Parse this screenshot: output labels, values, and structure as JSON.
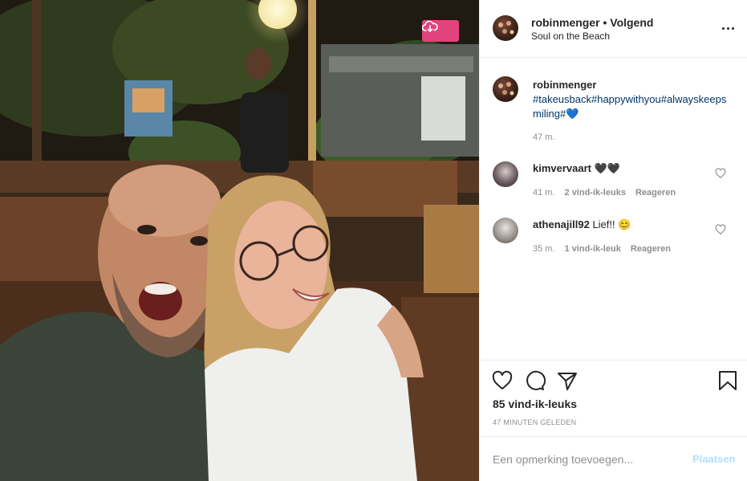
{
  "post": {
    "photo_alt": "Selfie foto",
    "download_icon": "cloud-download-icon"
  },
  "header": {
    "username": "robinmenger",
    "separator": " • ",
    "follow_state": "Volgend",
    "location": "Soul on the Beach",
    "more_icon": "more-options-icon"
  },
  "caption": {
    "username": "robinmenger",
    "text": "#takeusback#happywithyou#alwayskeepsmiling#💙",
    "time": "47 m."
  },
  "comments": [
    {
      "username": "kimvervaart",
      "text": "🖤🖤",
      "time": "41 m.",
      "likes": "2 vind-ik-leuks",
      "reply": "Reageren"
    },
    {
      "username": "athenajill92",
      "text": "Lief!! 😊",
      "time": "35 m.",
      "likes": "1 vind-ik-leuk",
      "reply": "Reageren"
    }
  ],
  "actions": {
    "like_icon": "heart-icon",
    "comment_icon": "comment-icon",
    "share_icon": "share-icon",
    "save_icon": "bookmark-icon"
  },
  "stats": {
    "likes": "85 vind-ik-leuks",
    "posted_ago": "47 MINUTEN GELEDEN"
  },
  "add_comment": {
    "placeholder": "Een opmerking toevoegen...",
    "value": "",
    "post_label": "Plaatsen"
  },
  "colors": {
    "download_button": "#e2437c",
    "hashtag": "#003569",
    "muted": "#8e8e8e",
    "post_button_disabled": "#b2dffc"
  }
}
